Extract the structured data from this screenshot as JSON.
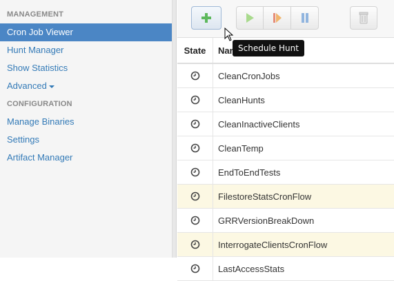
{
  "sidebar": {
    "sections": [
      {
        "label": "MANAGEMENT"
      },
      {
        "label": "CONFIGURATION"
      }
    ],
    "management_items": [
      {
        "label": "Cron Job Viewer",
        "active": true
      },
      {
        "label": "Hunt Manager"
      },
      {
        "label": "Show Statistics"
      },
      {
        "label": "Advanced"
      }
    ],
    "configuration_items": [
      {
        "label": "Manage Binaries"
      },
      {
        "label": "Settings"
      },
      {
        "label": "Artifact Manager"
      }
    ]
  },
  "toolbar": {
    "buttons": [
      {
        "name": "add",
        "icon": "plus-icon",
        "color": "#5cb85c"
      },
      {
        "name": "start",
        "icon": "play-icon",
        "color": "#8fd16a"
      },
      {
        "name": "force-run",
        "icon": "force-run-icon",
        "color": "#e06a50"
      },
      {
        "name": "pause",
        "icon": "pause-icon",
        "color": "#6f9fd8"
      },
      {
        "name": "delete",
        "icon": "trash-icon",
        "color": "#bbbbbb"
      }
    ],
    "tooltip": "Schedule Hunt"
  },
  "table": {
    "headers": {
      "state": "State",
      "name": "Name"
    },
    "rows": [
      {
        "name": "CleanCronJobs",
        "state_icon": "clock-icon",
        "highlight": false
      },
      {
        "name": "CleanHunts",
        "state_icon": "clock-icon",
        "highlight": false
      },
      {
        "name": "CleanInactiveClients",
        "state_icon": "clock-icon",
        "highlight": false
      },
      {
        "name": "CleanTemp",
        "state_icon": "clock-icon",
        "highlight": false
      },
      {
        "name": "EndToEndTests",
        "state_icon": "clock-icon",
        "highlight": false
      },
      {
        "name": "FilestoreStatsCronFlow",
        "state_icon": "clock-icon",
        "highlight": true
      },
      {
        "name": "GRRVersionBreakDown",
        "state_icon": "clock-icon",
        "highlight": false
      },
      {
        "name": "InterrogateClientsCronFlow",
        "state_icon": "clock-icon",
        "highlight": true
      },
      {
        "name": "LastAccessStats",
        "state_icon": "clock-icon",
        "highlight": false
      }
    ]
  },
  "colors": {
    "active_bg": "#4b86c5",
    "link": "#337ab7",
    "highlight_row": "#fcf8e3"
  }
}
